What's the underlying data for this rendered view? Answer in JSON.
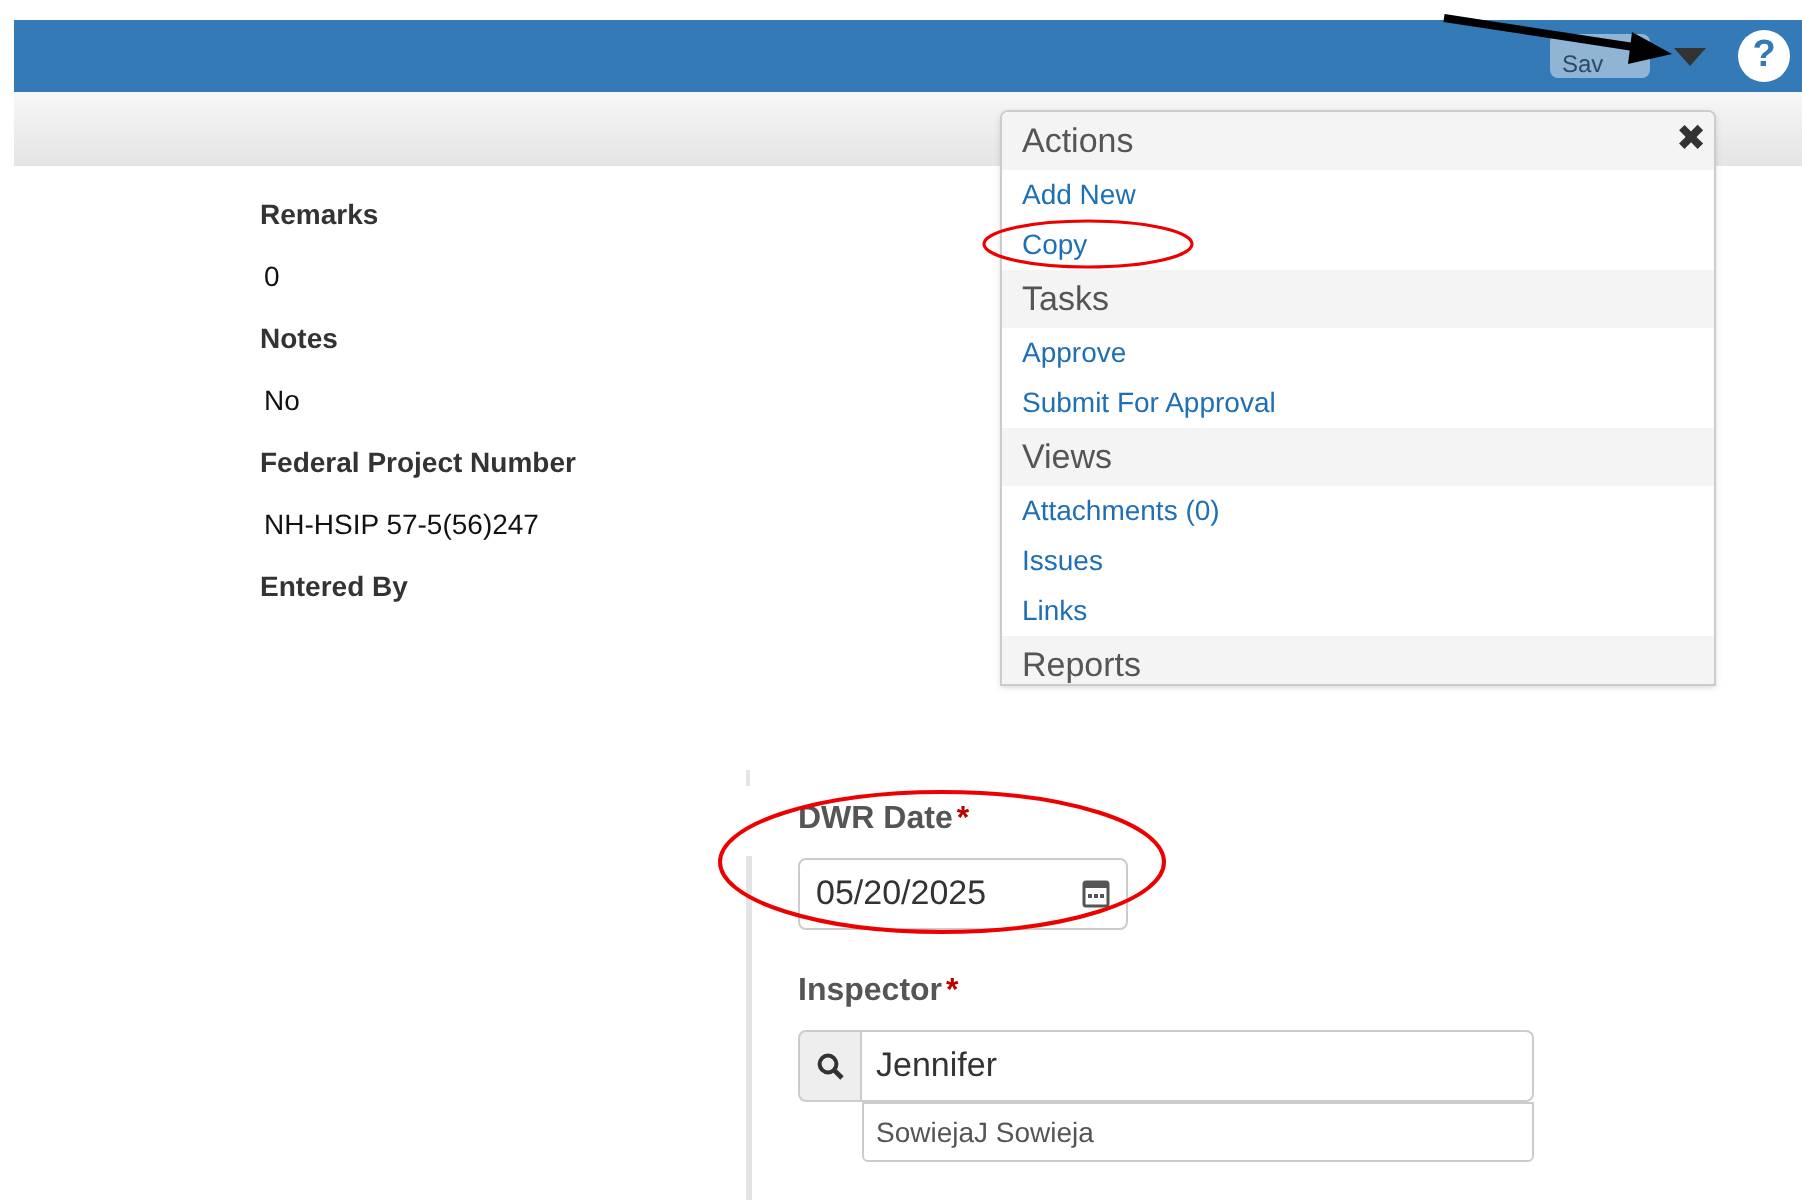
{
  "header": {
    "save_button": "Sav",
    "help": "?"
  },
  "details": [
    {
      "label": "Remarks",
      "value": "0"
    },
    {
      "label": "Notes",
      "value": "No"
    },
    {
      "label": "Federal Project Number",
      "value": "NH-HSIP 57-5(56)247"
    },
    {
      "label": "Entered By"
    }
  ],
  "menu": {
    "close": "✖",
    "sections": [
      {
        "title": "Actions",
        "items": [
          "Add New",
          "Copy"
        ]
      },
      {
        "title": "Tasks",
        "items": [
          "Approve",
          "Submit For Approval"
        ]
      },
      {
        "title": "Views",
        "items": [
          "Attachments (0)",
          "Issues",
          "Links"
        ]
      },
      {
        "title": "Reports"
      }
    ]
  },
  "form": {
    "date_label": "DWR Date",
    "date_required": "*",
    "date_value": "05/20/2025",
    "inspector_label": "Inspector",
    "inspector_required": "*",
    "inspector_value": "Jennifer",
    "suggestions": [
      "SowiejaJ Sowieja"
    ]
  }
}
